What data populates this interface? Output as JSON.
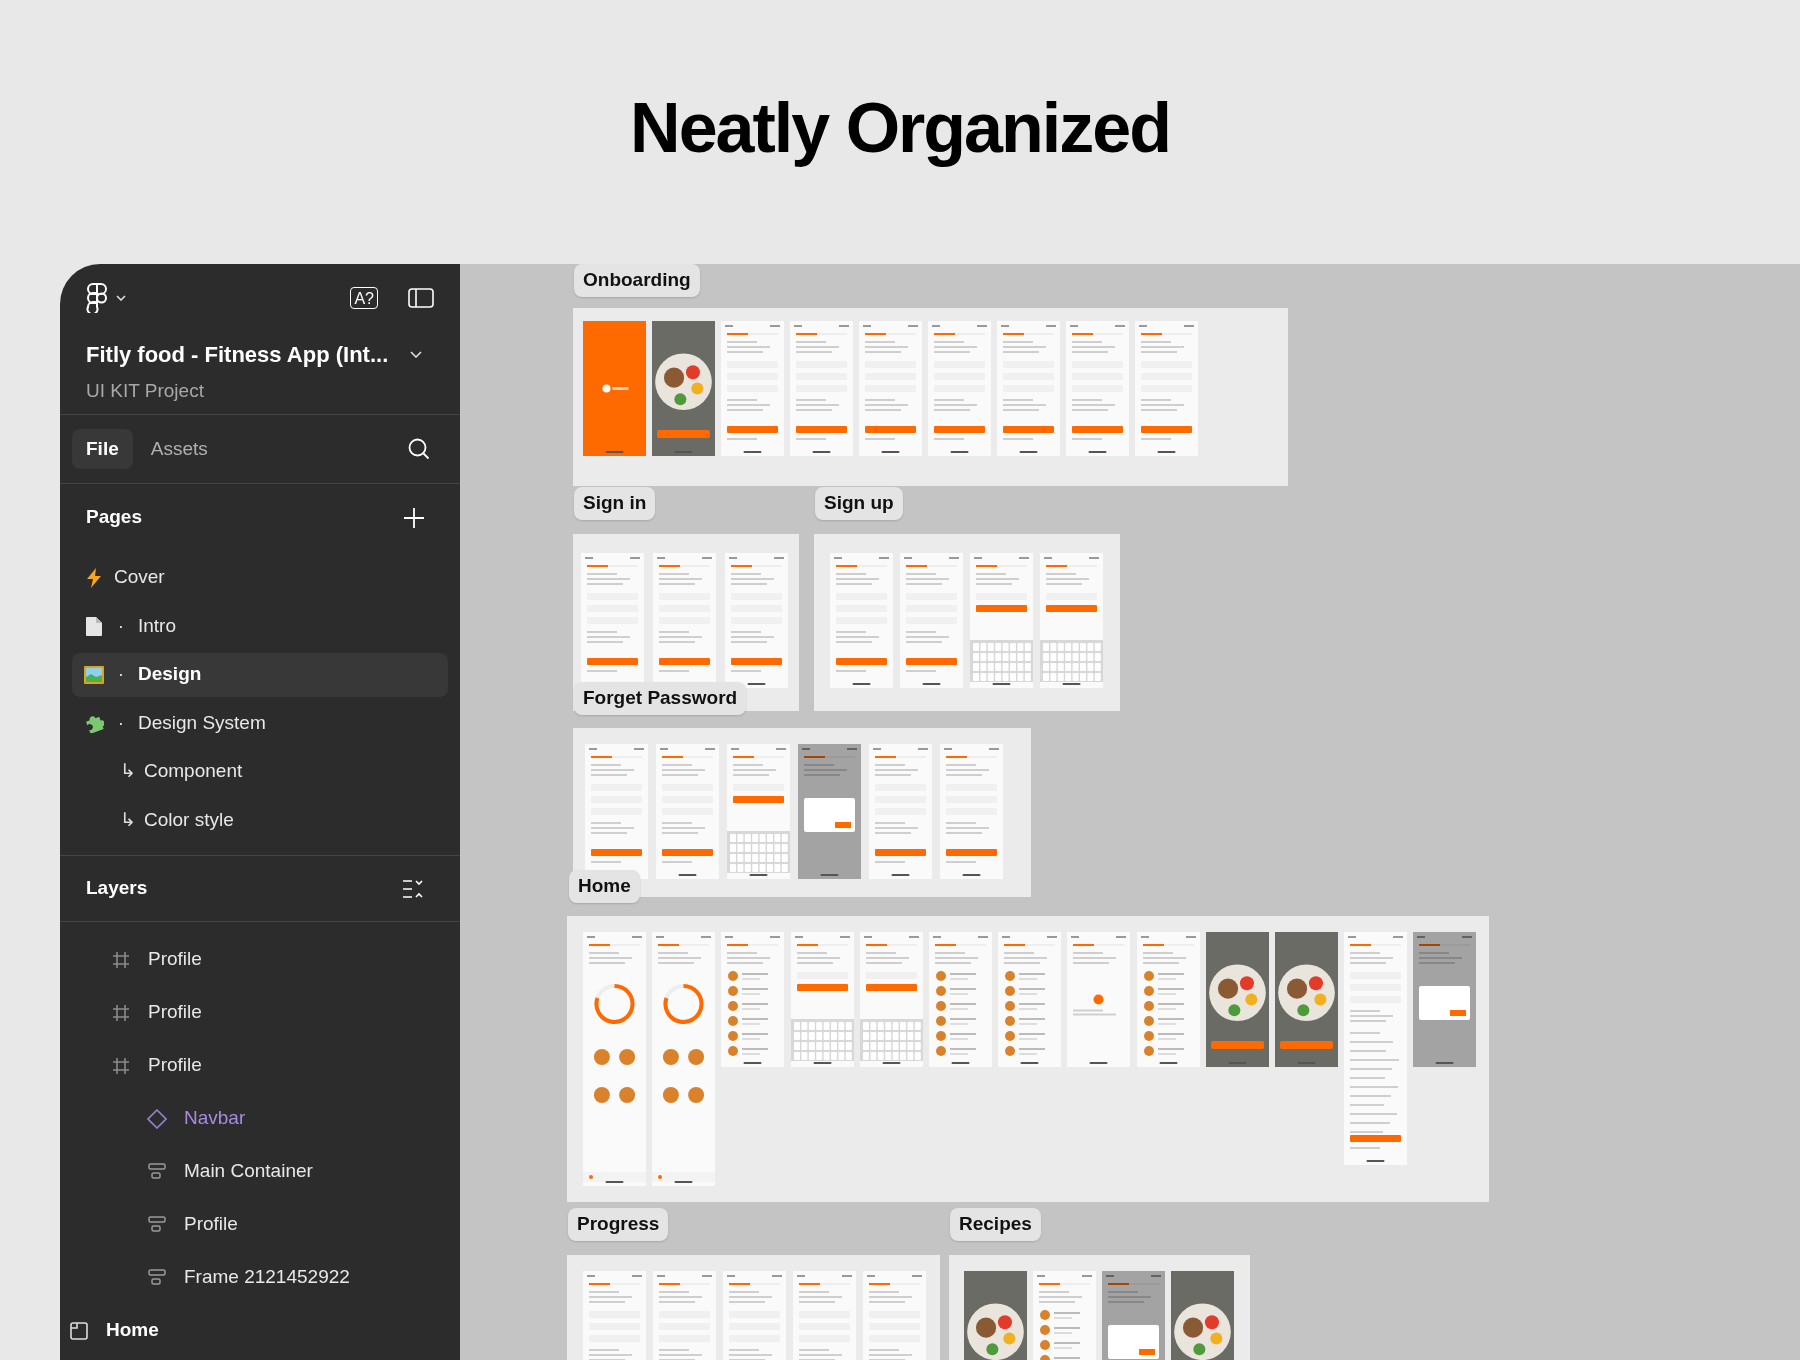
{
  "headline": "Neatly Organized",
  "toolbar": {
    "translate_label": "A?"
  },
  "project": {
    "title": "Fitly food - Fitness App (Int...",
    "subtitle": "UI KIT Project"
  },
  "tabs": [
    {
      "label": "File",
      "selected": true
    },
    {
      "label": "Assets",
      "selected": false
    }
  ],
  "pages": {
    "title": "Pages",
    "items": [
      {
        "label": "Cover",
        "kind": "bolt",
        "selected": false
      },
      {
        "label": "Intro",
        "marker": "·",
        "kind": "document",
        "selected": false
      },
      {
        "label": "Design",
        "marker": "·",
        "kind": "image",
        "selected": true
      },
      {
        "label": "Design System",
        "marker": "·",
        "kind": "puzzle",
        "selected": false,
        "children": [
          {
            "label": "Component",
            "marker": "↳",
            "selected": false
          },
          {
            "label": "Color style",
            "marker": "↳",
            "selected": false
          }
        ]
      }
    ]
  },
  "layers": {
    "title": "Layers",
    "items": [
      {
        "name": "Profile",
        "kind": "frame"
      },
      {
        "name": "Profile",
        "kind": "frame"
      },
      {
        "name": "Profile",
        "kind": "frame",
        "children": [
          {
            "name": "Navbar",
            "kind": "component"
          },
          {
            "name": "Main Container",
            "kind": "stack"
          },
          {
            "name": "Profile",
            "kind": "stack"
          },
          {
            "name": "Frame 2121452922",
            "kind": "stack"
          }
        ]
      },
      {
        "name": "Home",
        "kind": "section"
      }
    ]
  },
  "canvas": {
    "sections": [
      {
        "label": "Onboarding",
        "screens": [
          {
            "kind": "splash"
          },
          {
            "kind": "photo"
          },
          {
            "kind": "form"
          },
          {
            "kind": "form"
          },
          {
            "kind": "form"
          },
          {
            "kind": "form"
          },
          {
            "kind": "form"
          },
          {
            "kind": "form"
          },
          {
            "kind": "form"
          }
        ]
      },
      {
        "label": "Sign in",
        "screens": [
          {
            "kind": "form"
          },
          {
            "kind": "form"
          },
          {
            "kind": "form"
          }
        ]
      },
      {
        "label": "Sign up",
        "screens": [
          {
            "kind": "form"
          },
          {
            "kind": "form"
          },
          {
            "kind": "keyboard"
          },
          {
            "kind": "keyboard"
          }
        ]
      },
      {
        "label": "Forget Password",
        "screens": [
          {
            "kind": "form"
          },
          {
            "kind": "form"
          },
          {
            "kind": "keyboard"
          },
          {
            "kind": "modal"
          },
          {
            "kind": "form"
          },
          {
            "kind": "form"
          }
        ]
      },
      {
        "label": "Home",
        "screens": [
          {
            "kind": "ring"
          },
          {
            "kind": "ring"
          },
          {
            "kind": "list"
          },
          {
            "kind": "keyboard"
          },
          {
            "kind": "keyboard"
          },
          {
            "kind": "list"
          },
          {
            "kind": "list"
          },
          {
            "kind": "empty"
          },
          {
            "kind": "list"
          },
          {
            "kind": "photo"
          },
          {
            "kind": "photo"
          },
          {
            "kind": "long"
          },
          {
            "kind": "modal"
          }
        ]
      },
      {
        "label": "Progress",
        "screens": [
          {
            "kind": "form"
          },
          {
            "kind": "form"
          },
          {
            "kind": "form"
          },
          {
            "kind": "form"
          },
          {
            "kind": "form"
          }
        ]
      },
      {
        "label": "Recipes",
        "screens": [
          {
            "kind": "photo"
          },
          {
            "kind": "list"
          },
          {
            "kind": "modal"
          },
          {
            "kind": "photo"
          }
        ]
      }
    ]
  }
}
